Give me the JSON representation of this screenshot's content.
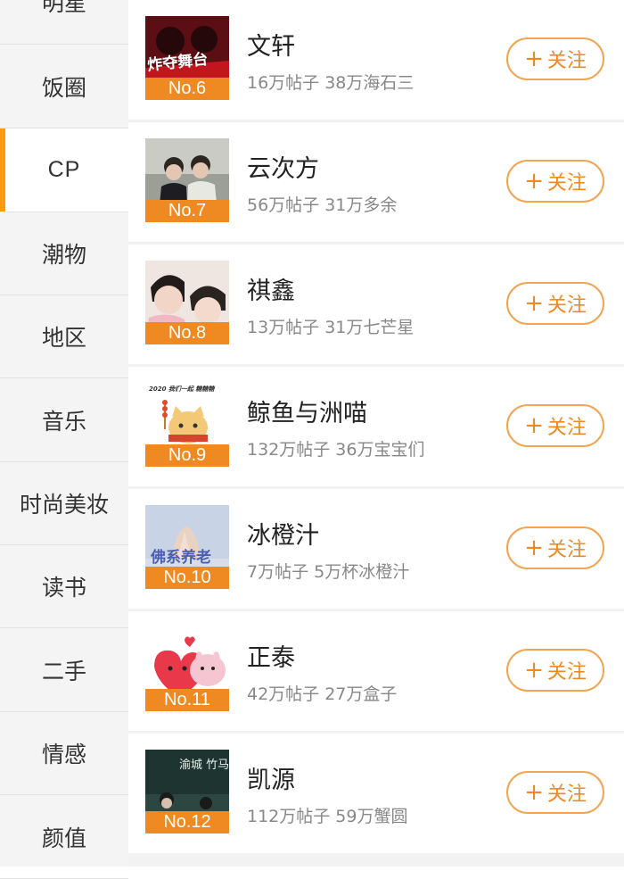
{
  "sidebar": {
    "items": [
      {
        "label": "明星"
      },
      {
        "label": "饭圈"
      },
      {
        "label": "CP"
      },
      {
        "label": "潮物"
      },
      {
        "label": "地区"
      },
      {
        "label": "音乐"
      },
      {
        "label": "时尚美妆"
      },
      {
        "label": "读书"
      },
      {
        "label": "二手"
      },
      {
        "label": "情感"
      },
      {
        "label": "颜值"
      }
    ],
    "active_index": 2
  },
  "accent_color": "#ef8a22",
  "follow_label": "关注",
  "follow_plus": "+",
  "rows": [
    {
      "rank": "No.6",
      "name": "文轩",
      "stats": "16万帖子 38万海石三",
      "thumb_text": "炸夺舞台"
    },
    {
      "rank": "No.7",
      "name": "云次方",
      "stats": "56万帖子 31万多余"
    },
    {
      "rank": "No.8",
      "name": "祺鑫",
      "stats": "13万帖子 31万七芒星"
    },
    {
      "rank": "No.9",
      "name": "鲸鱼与洲喵",
      "stats": "132万帖子 36万宝宝们",
      "thumb_text": "2020 我们一起 糖糖糖"
    },
    {
      "rank": "No.10",
      "name": "冰橙汁",
      "stats": "7万帖子 5万杯冰橙汁",
      "thumb_text": "佛系养老"
    },
    {
      "rank": "No.11",
      "name": "正泰",
      "stats": "42万帖子 27万盒子"
    },
    {
      "rank": "No.12",
      "name": "凯源",
      "stats": "112万帖子 59万蟹圆",
      "thumb_text": "渝城 竹马"
    }
  ]
}
